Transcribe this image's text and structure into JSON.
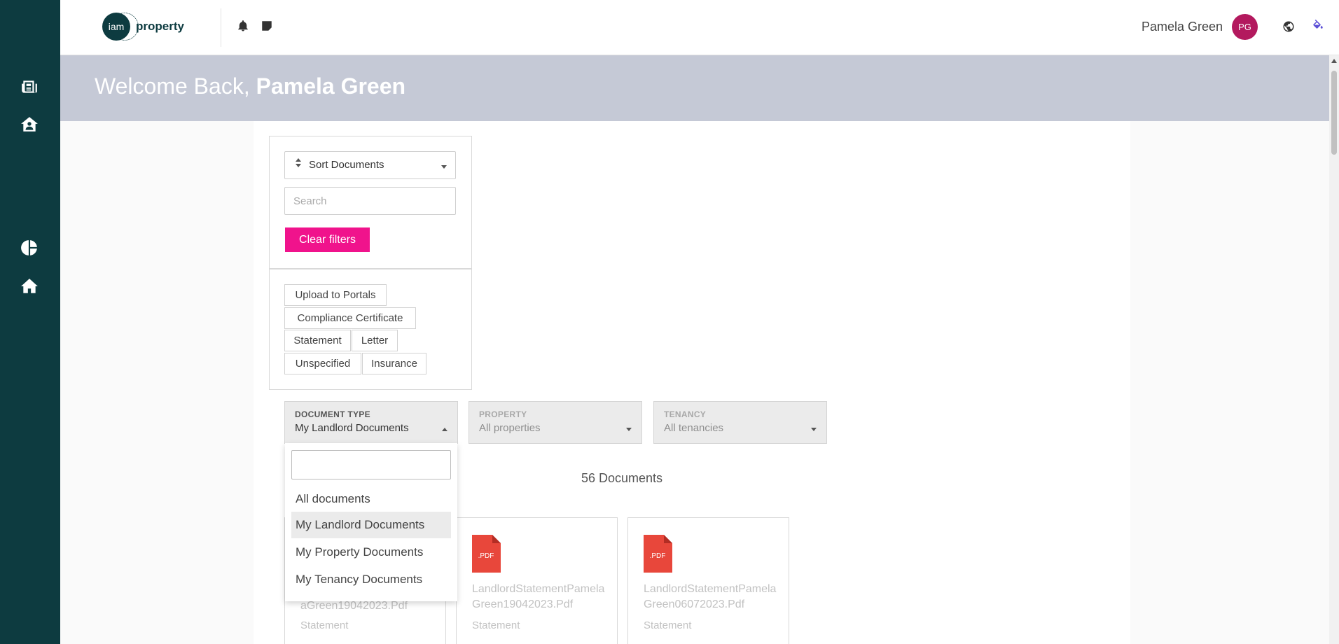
{
  "header": {
    "logo_iam": "iam",
    "logo_property": "property",
    "user_name": "Pamela Green",
    "avatar_initials": "PG"
  },
  "banner": {
    "greeting": "Welcome Back, ",
    "name": "Pamela Green"
  },
  "filters": {
    "sort_label": "Sort Documents",
    "search_placeholder": "Search",
    "clear_label": "Clear filters",
    "tags": [
      "Upload to Portals",
      "Compliance Certificate",
      "Statement",
      "Letter",
      "Unspecified",
      "Insurance"
    ]
  },
  "dropdowns": {
    "document_type": {
      "label": "DOCUMENT TYPE",
      "value": "My Landlord Documents"
    },
    "property": {
      "label": "PROPERTY",
      "value": "All properties"
    },
    "tenancy": {
      "label": "TENANCY",
      "value": "All tenancies"
    }
  },
  "document_count": "56 Documents",
  "menu": {
    "options": [
      "All documents",
      "My Landlord Documents",
      "My Property Documents",
      "My Tenancy Documents"
    ],
    "selected": "My Landlord Documents"
  },
  "documents": [
    {
      "title": "aGreen19042023.Pdf",
      "type": "Statement"
    },
    {
      "title": "LandlordStatementPamelaGreen19042023.Pdf",
      "type": "Statement",
      "badge": ".PDF"
    },
    {
      "title": "LandlordStatementPamelaGreen06072023.Pdf",
      "type": "Statement",
      "badge": ".PDF"
    }
  ],
  "colors": {
    "sidebar": "#0d3b40",
    "banner": "#c5c9d6",
    "accent": "#f0138c",
    "avatar": "#b3195e",
    "pdf": "#e8473b"
  },
  "icons": {
    "sidebar": [
      "newspaper-icon",
      "user-home-icon",
      "pie-chart-icon",
      "home-icon"
    ],
    "topbar": [
      "bell-icon",
      "sticky-note-icon",
      "globe-icon",
      "paint-bucket-icon"
    ]
  }
}
